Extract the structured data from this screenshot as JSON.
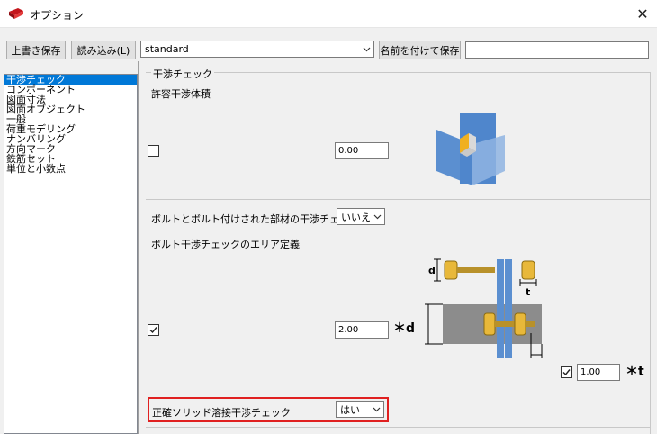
{
  "window": {
    "title": "オプション",
    "close_glyph": "✕"
  },
  "toolbar": {
    "overwrite_save": "上書き保存",
    "load": "読み込み(L)",
    "preset_value": "standard",
    "save_as": "名前を付けて保存",
    "name_field_value": ""
  },
  "nav": {
    "items": [
      {
        "label": "干渉チェック",
        "selected": true
      },
      {
        "label": "コンポーネント",
        "selected": false
      },
      {
        "label": "図面寸法",
        "selected": false
      },
      {
        "label": "図面オブジェクト",
        "selected": false
      },
      {
        "label": "一般",
        "selected": false
      },
      {
        "label": "荷重モデリング",
        "selected": false
      },
      {
        "label": "ナンバリング",
        "selected": false
      },
      {
        "label": "方向マーク",
        "selected": false
      },
      {
        "label": "鉄筋セット",
        "selected": false
      },
      {
        "label": "単位と小数点",
        "selected": false
      }
    ]
  },
  "clash": {
    "section_title": "干渉チェック",
    "tolerance_label": "許容干渉体積",
    "tolerance_checked": false,
    "tolerance_value": "0.00",
    "bolt_clash_label": "ボルトとボルト付けされた部材の干渉チェック:",
    "bolt_clash_value": "いいえ",
    "bolt_area_label": "ボルト干渉チェックのエリア定義",
    "bolt_area_checked": true,
    "d_multiplier_value": "2.00",
    "d_multiplier_suffix": "＊d",
    "t_checked": true,
    "t_multiplier_value": "1.00",
    "t_multiplier_suffix": "＊t",
    "diagram_d": "d",
    "diagram_t": "t",
    "solid_weld_label": "正確ソリッド溶接干渉チェック",
    "solid_weld_value": "はい"
  },
  "colors": {
    "selection": "#0078d7",
    "highlight": "#e02020",
    "plate": "#5b8fd0",
    "bolt": "#e8b83a"
  }
}
